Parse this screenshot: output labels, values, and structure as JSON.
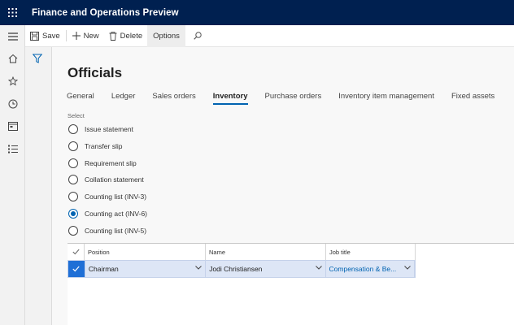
{
  "app": {
    "title": "Finance and Operations Preview"
  },
  "actions": {
    "save": "Save",
    "new": "New",
    "delete": "Delete",
    "options": "Options"
  },
  "nav_icons": [
    "hamburger-icon",
    "home-icon",
    "star-icon",
    "clock-icon",
    "workspace-icon",
    "list-icon"
  ],
  "page": {
    "title": "Officials",
    "tabs": [
      {
        "label": "General",
        "active": false
      },
      {
        "label": "Ledger",
        "active": false
      },
      {
        "label": "Sales orders",
        "active": false
      },
      {
        "label": "Inventory",
        "active": true
      },
      {
        "label": "Purchase orders",
        "active": false
      },
      {
        "label": "Inventory item management",
        "active": false
      },
      {
        "label": "Fixed assets",
        "active": false
      }
    ],
    "select_label": "Select",
    "options": [
      {
        "label": "Issue statement",
        "checked": false
      },
      {
        "label": "Transfer slip",
        "checked": false
      },
      {
        "label": "Requirement slip",
        "checked": false
      },
      {
        "label": "Collation statement",
        "checked": false
      },
      {
        "label": "Counting list (INV-3)",
        "checked": false
      },
      {
        "label": "Counting act (INV-6)",
        "checked": true
      },
      {
        "label": "Counting list (INV-5)",
        "checked": false
      }
    ]
  },
  "grid": {
    "columns": [
      "Position",
      "Name",
      "Job title"
    ],
    "rows": [
      {
        "position": "Chairman",
        "name": "Jodi Christiansen",
        "job_title": "Compensation & Be..."
      }
    ]
  },
  "colors": {
    "topbar": "#002050",
    "accent": "#0063b1",
    "selected_row": "#dde6f6"
  }
}
